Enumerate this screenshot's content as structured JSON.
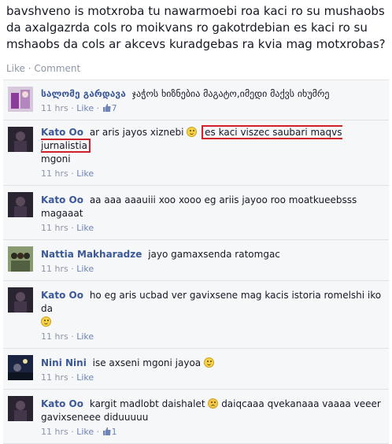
{
  "post": {
    "text": "bavshveno is motxroba tu nawarmoebi roa kaci ro su mushaobs da axalgazrda cols ro moikvans ro gakotrdebian es kaci ro su mshaobs da cols ar akcevs kuradgebas ra kvia mag motxrobas?",
    "actions": [
      "Like",
      "Comment"
    ],
    "separator": "·"
  },
  "comments": [
    {
      "author": "სალომე გარდავა",
      "text": "ჯაჭოს ხიზნებია მაგატო,იმედი მაქვს იხუმრე",
      "time": "11 hrs",
      "like": "Like",
      "likes": "7",
      "avatar": "purple"
    },
    {
      "author": "Kato Oo",
      "text_before": "ar aris jayos xiznebi",
      "emoji": "smile",
      "highlight": "es kaci viszec saubari maqvs jurnalistia",
      "text_after": "mgoni",
      "time": "11 hrs",
      "like": "Like",
      "avatar": "dark"
    },
    {
      "author": "Kato Oo",
      "text": "aa aaa aaauiii xoo xooo eg ariis jayoo roo moatkueebsss magaaat",
      "time": "11 hrs",
      "like": "Like",
      "avatar": "dark"
    },
    {
      "author": "Nattia Makharadze",
      "text": "jayo gamaxsenda ratomgac",
      "time": "11 hrs",
      "like": "Like",
      "avatar": "group"
    },
    {
      "author": "Kato Oo",
      "text": "ho eg aris ucbad ver gavixsene mag kacis istoria romelshi iko da",
      "emoji": "smile",
      "time": "11 hrs",
      "like": "Like",
      "avatar": "dark"
    },
    {
      "author": "Nini Nini",
      "text": "ise axseni mgoni jayoa",
      "emoji": "smile",
      "time": "11 hrs",
      "like": "Like",
      "avatar": "night"
    },
    {
      "author": "Kato Oo",
      "text_before": "kargit madlobt daishalet",
      "emoji": "worried",
      "text_mid": "daiqcaaa qvekanaaa vaaaa veeer",
      "text_after": "gavixseneee diduuuuu",
      "time": "11 hrs",
      "like": "Like",
      "likes": "1",
      "avatar": "dark"
    }
  ],
  "colors": {
    "link": "#3b5998",
    "highlight_border": "#d0202a",
    "meta": "#8d95a6"
  }
}
